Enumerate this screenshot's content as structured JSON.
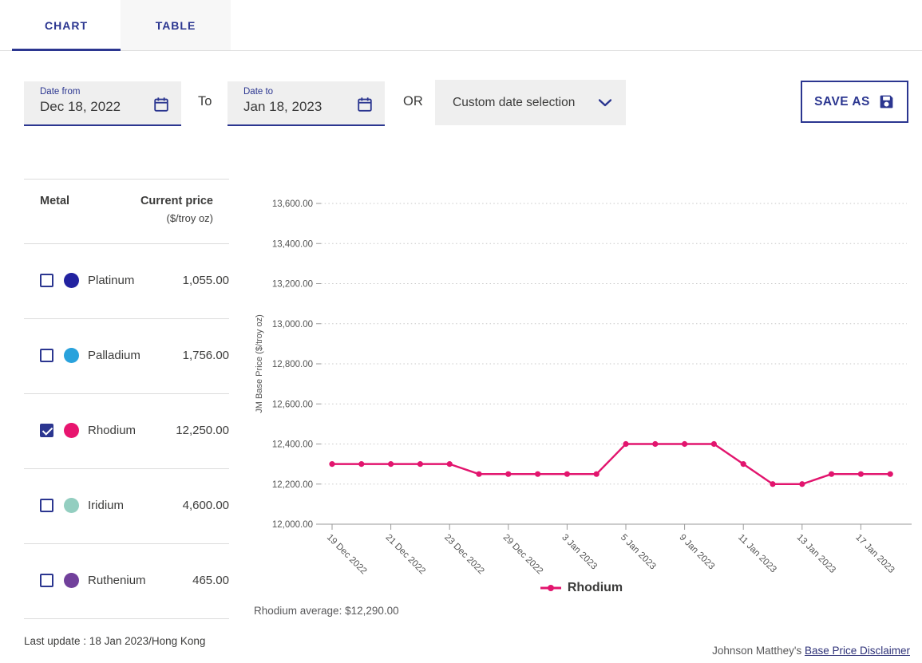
{
  "theme": {
    "accent_navy": "#2b3690",
    "line_pink": "#e2156e",
    "field_gray": "#efefef"
  },
  "tabs": {
    "chart": "CHART",
    "table": "TABLE"
  },
  "filters": {
    "date_from": {
      "label": "Date from",
      "value": "Dec 18, 2022"
    },
    "to_label": "To",
    "date_to": {
      "label": "Date to",
      "value": "Jan 18, 2023"
    },
    "or_label": "OR",
    "custom_select": {
      "value": "Custom date selection"
    },
    "save_as_label": "SAVE AS"
  },
  "metals_panel": {
    "header": {
      "metal": "Metal",
      "price_line1": "Current price",
      "price_line2": "($/troy oz)"
    },
    "rows": [
      {
        "name": "Platinum",
        "price": "1,055.00",
        "color": "#2222a0",
        "checked": false
      },
      {
        "name": "Palladium",
        "price": "1,756.00",
        "color": "#29a2dc",
        "checked": false
      },
      {
        "name": "Rhodium",
        "price": "12,250.00",
        "color": "#e8156f",
        "checked": true
      },
      {
        "name": "Iridium",
        "price": "4,600.00",
        "color": "#93cec0",
        "checked": false
      },
      {
        "name": "Ruthenium",
        "price": "465.00",
        "color": "#71409b",
        "checked": false
      }
    ],
    "last_update": "Last update : 18 Jan 2023/Hong Kong"
  },
  "chart_data": {
    "type": "line",
    "ylabel": "JM Base Price ($/troy oz)",
    "ylim": [
      12000,
      13600
    ],
    "y_ticks": [
      {
        "value": 12000,
        "label": "12,000.00"
      },
      {
        "value": 12200,
        "label": "12,200.00"
      },
      {
        "value": 12400,
        "label": "12,400.00"
      },
      {
        "value": 12600,
        "label": "12,600.00"
      },
      {
        "value": 12800,
        "label": "12,800.00"
      },
      {
        "value": 13000,
        "label": "13,000.00"
      },
      {
        "value": 13200,
        "label": "13,200.00"
      },
      {
        "value": 13400,
        "label": "13,400.00"
      },
      {
        "value": 13600,
        "label": "13,600.00"
      }
    ],
    "x": [
      "19 Dec 2022",
      "20 Dec 2022",
      "21 Dec 2022",
      "22 Dec 2022",
      "23 Dec 2022",
      "28 Dec 2022",
      "29 Dec 2022",
      "30 Dec 2022",
      "3 Jan 2023",
      "4 Jan 2023",
      "5 Jan 2023",
      "6 Jan 2023",
      "9 Jan 2023",
      "10 Jan 2023",
      "11 Jan 2023",
      "12 Jan 2023",
      "13 Jan 2023",
      "16 Jan 2023",
      "17 Jan 2023",
      "18 Jan 2023"
    ],
    "x_ticks": [
      {
        "index": 0,
        "label": "19 Dec 2022"
      },
      {
        "index": 2,
        "label": "21 Dec 2022"
      },
      {
        "index": 4,
        "label": "23 Dec 2022"
      },
      {
        "index": 6,
        "label": "29 Dec 2022"
      },
      {
        "index": 8,
        "label": "3 Jan 2023"
      },
      {
        "index": 10,
        "label": "5 Jan 2023"
      },
      {
        "index": 12,
        "label": "9 Jan 2023"
      },
      {
        "index": 14,
        "label": "11 Jan 2023"
      },
      {
        "index": 16,
        "label": "13 Jan 2023"
      },
      {
        "index": 18,
        "label": "17 Jan 2023"
      }
    ],
    "series": [
      {
        "name": "Rhodium",
        "color": "#e2156e",
        "values": [
          12300,
          12300,
          12300,
          12300,
          12300,
          12250,
          12250,
          12250,
          12250,
          12250,
          12400,
          12400,
          12400,
          12400,
          12300,
          12200,
          12200,
          12250,
          12250,
          12250
        ]
      }
    ],
    "grid": "dotted-horizontal",
    "legend_position": "bottom-center"
  },
  "chart_footer": {
    "average": "Rhodium average: $12,290.00"
  },
  "footer": {
    "prefix": "Johnson Matthey's ",
    "link": "Base Price Disclaimer"
  }
}
